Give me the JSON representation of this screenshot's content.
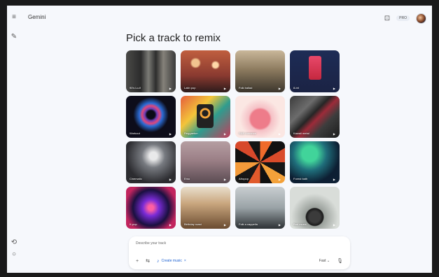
{
  "app": {
    "title": "Gemini"
  },
  "sidebar": {
    "menu_icon": "≡",
    "new_chat_icon": "✎",
    "activity_icon": "⟲",
    "settings_icon": "○"
  },
  "header": {
    "canvas_icon": "⊡",
    "pro_label": "PRO"
  },
  "main": {
    "heading": "Pick a track to remix",
    "tracks": [
      {
        "label": "90's Lo-fi"
      },
      {
        "label": "Latin pop"
      },
      {
        "label": "Folk ballad"
      },
      {
        "label": "8-bit"
      },
      {
        "label": "Workout"
      },
      {
        "label": "Reggaeton"
      },
      {
        "label": "R&B romance"
      },
      {
        "label": "Kawaii metal"
      },
      {
        "label": "Cinematic"
      },
      {
        "label": "Emo"
      },
      {
        "label": "Afropop"
      },
      {
        "label": "Forest bath"
      },
      {
        "label": "K-pop"
      },
      {
        "label": "Birthday roast"
      },
      {
        "label": "Folk a cappella"
      },
      {
        "label": "Bad music"
      }
    ],
    "play_icon": "▶"
  },
  "composer": {
    "placeholder": "Describe your track",
    "add_icon": "+",
    "tools_icon": "⇆",
    "chip_icon": "♪",
    "chip_label": "Create music",
    "chip_close": "×",
    "mode_label": "Fast",
    "mode_caret": "⌄",
    "mic_icon": "🎙"
  }
}
